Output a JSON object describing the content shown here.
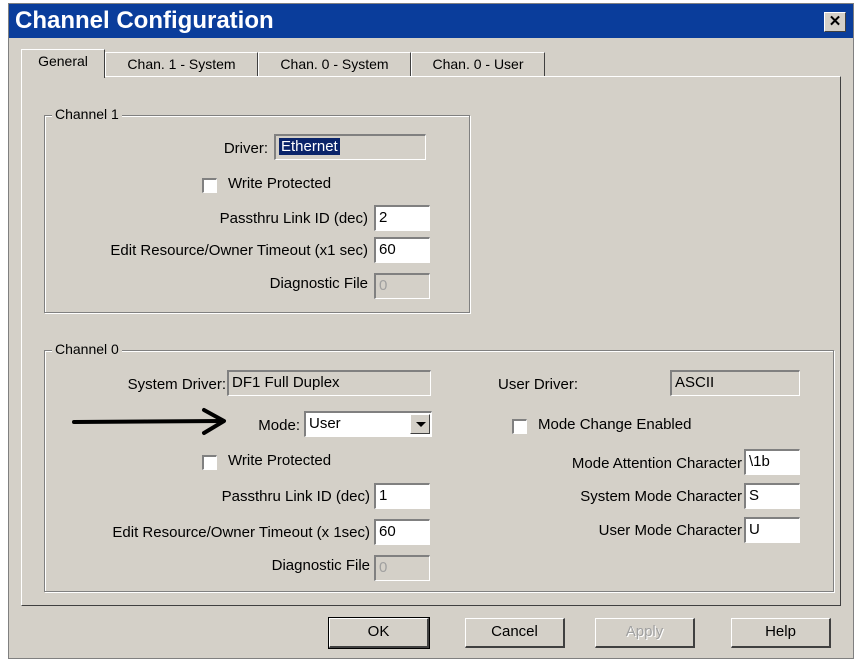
{
  "window": {
    "title": "Channel Configuration",
    "close_glyph": "✕"
  },
  "tabs": [
    "General",
    "Chan. 1 - System",
    "Chan. 0 - System",
    "Chan. 0 - User"
  ],
  "channel1": {
    "group_label": "Channel 1",
    "driver_label": "Driver:",
    "driver_value": "Ethernet",
    "write_protected_label": "Write Protected",
    "passthru_label": "Passthru Link ID (dec)",
    "passthru_value": "2",
    "timeout_label": "Edit Resource/Owner Timeout (x1 sec)",
    "timeout_value": "60",
    "diag_label": "Diagnostic File",
    "diag_value": "0"
  },
  "channel0": {
    "group_label": "Channel 0",
    "system_driver_label": "System Driver:",
    "system_driver_value": "DF1 Full Duplex",
    "user_driver_label": "User Driver:",
    "user_driver_value": "ASCII",
    "mode_label": "Mode:",
    "mode_value": "User",
    "mode_change_label": "Mode Change Enabled",
    "write_protected_label": "Write Protected",
    "attention_label": "Mode Attention Character",
    "attention_value": "\\1b",
    "passthru_label": "Passthru Link ID (dec)",
    "passthru_value": "1",
    "system_mode_label": "System Mode Character",
    "system_mode_value": "S",
    "timeout_label": "Edit Resource/Owner Timeout (x 1sec)",
    "timeout_value": "60",
    "user_mode_label": "User Mode Character",
    "user_mode_value": "U",
    "diag_label": "Diagnostic File",
    "diag_value": "0"
  },
  "buttons": {
    "ok": "OK",
    "cancel": "Cancel",
    "apply": "Apply",
    "help": "Help"
  },
  "colors": {
    "titlebar": "#0a3d9b",
    "dialog": "#d4d0c8",
    "selection": "#0a246a"
  },
  "icons": {
    "close": "close-icon",
    "dropdown": "chevron-down-icon",
    "arrow": "arrow-right-icon"
  }
}
